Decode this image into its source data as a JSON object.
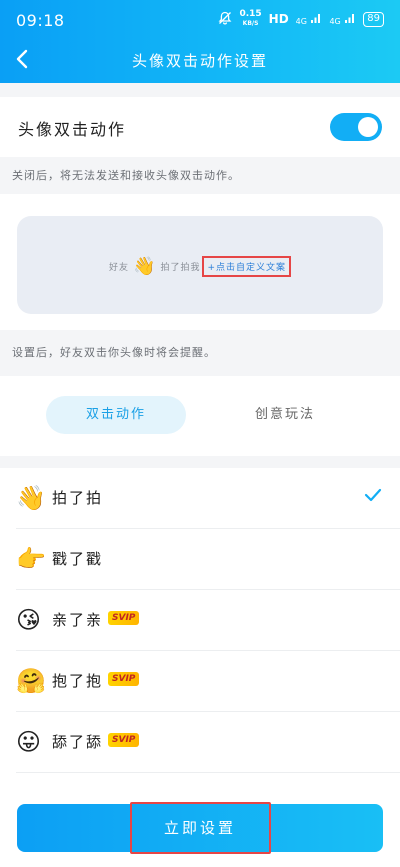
{
  "status_bar": {
    "time": "09:18",
    "net_speed": "0.15",
    "net_unit": "KB/S",
    "hd": "HD",
    "signal1": "4G",
    "signal2": "4G",
    "battery": "89"
  },
  "nav": {
    "title": "头像双击动作设置"
  },
  "toggle_row": {
    "label": "头像双击动作",
    "enabled": true
  },
  "hint_off": "关闭后，将无法发送和接收头像双击动作。",
  "preview": {
    "prefix": "好友",
    "suffix": "拍了拍我",
    "custom_link": "+点击自定义文案"
  },
  "hint_set": "设置后，好友双击你头像时将会提醒。",
  "tabs": [
    {
      "label": "双击动作",
      "active": true
    },
    {
      "label": "创意玩法",
      "active": false
    }
  ],
  "actions": [
    {
      "label": "拍了拍",
      "icon": "waving-hand-icon",
      "svip": "",
      "selected": true
    },
    {
      "label": "戳了戳",
      "icon": "pointing-finger-icon",
      "svip": "",
      "selected": false
    },
    {
      "label": "亲了亲",
      "icon": "kiss-face-icon",
      "svip": "SVIP",
      "selected": false
    },
    {
      "label": "抱了抱",
      "icon": "hug-face-icon",
      "svip": "SVIP",
      "selected": false
    },
    {
      "label": "舔了舔",
      "icon": "lick-face-icon",
      "svip": "SVIP",
      "selected": false
    }
  ],
  "set_button": "立即设置",
  "colors": {
    "accent": "#12aef5",
    "highlight_box": "#e64646",
    "svip_bg": "#ffc400",
    "svip_text": "#c0261f"
  }
}
